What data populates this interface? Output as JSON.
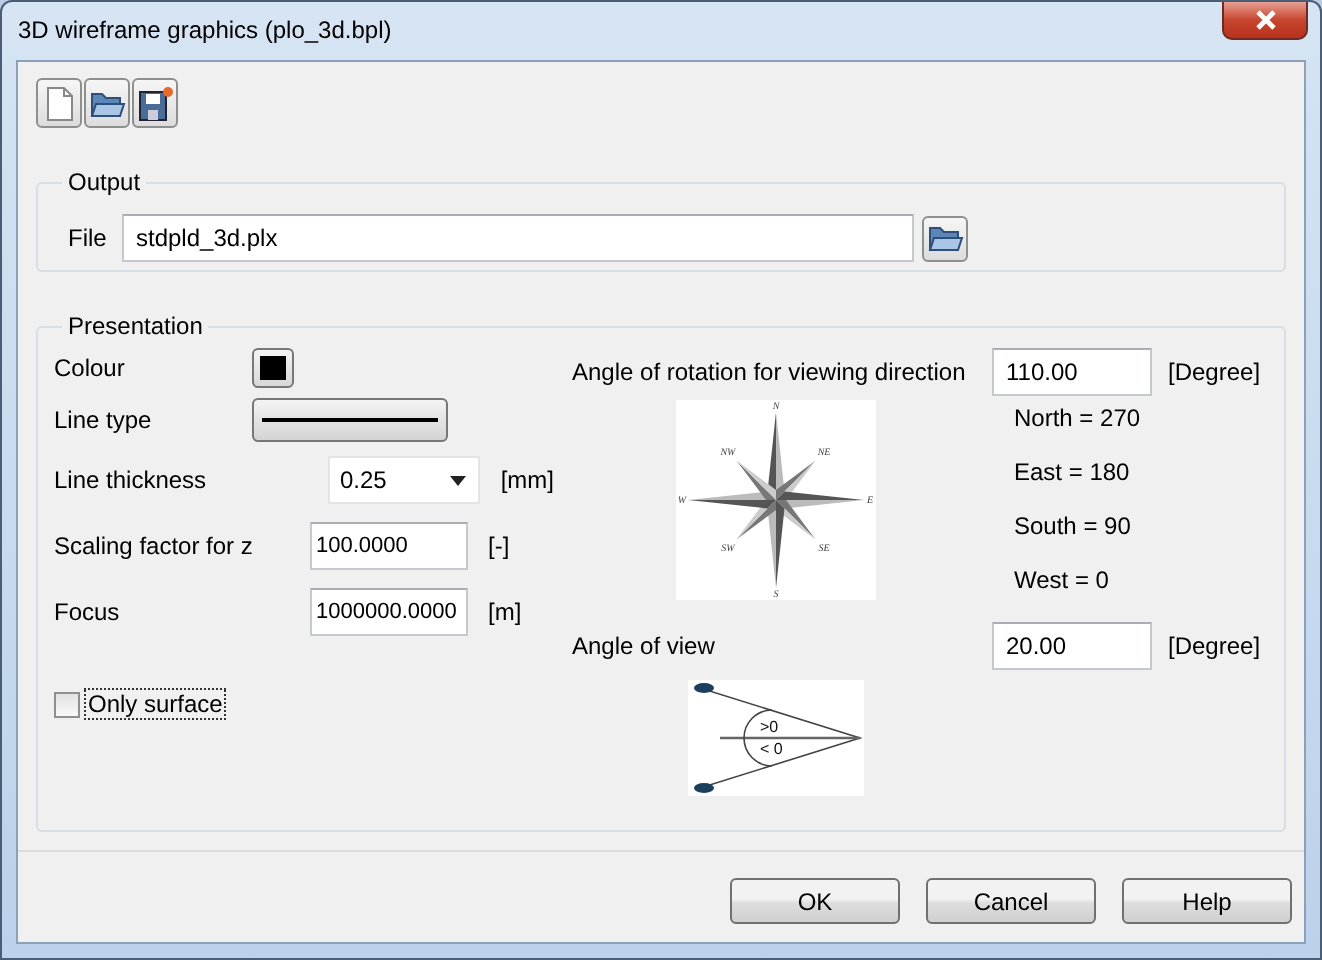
{
  "window": {
    "title": "3D wireframe graphics (plo_3d.bpl)"
  },
  "toolbar": [
    {
      "kind": "new"
    },
    {
      "kind": "open"
    },
    {
      "kind": "save"
    }
  ],
  "output": {
    "title": "Output",
    "file_label": "File",
    "file_value": "stdpld_3d.plx"
  },
  "presentation": {
    "title": "Presentation",
    "colour": {
      "label": "Colour",
      "color": "#000000"
    },
    "line_type": {
      "label": "Line type"
    },
    "line_thickness": {
      "label": "Line thickness",
      "value": "0.25",
      "unit": "[mm]"
    },
    "scaling": {
      "label": "Scaling factor for z",
      "value": "100.0000",
      "unit": "[-]"
    },
    "focus": {
      "label": "Focus",
      "value": "1000000.0000",
      "unit": "[m]"
    },
    "only_surface": {
      "label": "Only surface",
      "checked": false
    },
    "rotation": {
      "label": "Angle of rotation for viewing direction",
      "value": "110.00",
      "unit": "[Degree]",
      "compass_labels": [
        "N",
        "NE",
        "E",
        "SE",
        "S",
        "SW",
        "W",
        "NW"
      ],
      "directions": [
        "North = 270",
        "East = 180",
        "South = 90",
        "West = 0"
      ]
    },
    "view": {
      "label": "Angle of view",
      "value": "20.00",
      "unit": "[Degree]",
      "diagram_labels": [
        ">0",
        "< 0"
      ]
    }
  },
  "buttons": [
    "OK",
    "Cancel",
    "Help"
  ]
}
